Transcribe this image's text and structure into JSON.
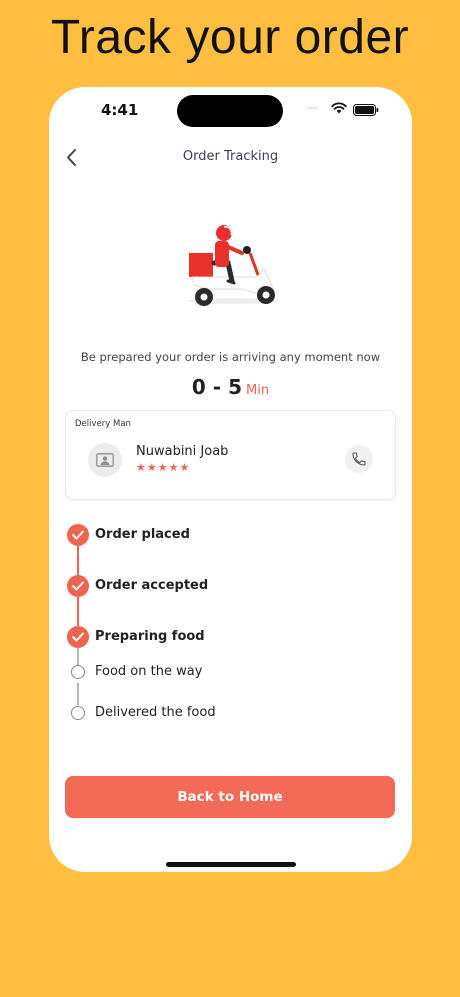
{
  "promo": {
    "title": "Track your order"
  },
  "status_bar": {
    "time": "4:41",
    "signal": "····"
  },
  "header": {
    "title": "Order Tracking"
  },
  "arrival": {
    "message": "Be prepared your order is arriving any moment now",
    "eta_value": "0 - 5",
    "eta_unit": "Min"
  },
  "delivery": {
    "label": "Delivery Man",
    "name": "Nuwabini Joab",
    "rating": 5,
    "stars": "★★★★★"
  },
  "steps": [
    {
      "label": "Order placed",
      "done": true
    },
    {
      "label": "Order accepted",
      "done": true
    },
    {
      "label": "Preparing food",
      "done": true
    },
    {
      "label": "Food on the way",
      "done": false
    },
    {
      "label": "Delivered the food",
      "done": false
    }
  ],
  "actions": {
    "back_home": "Back to Home"
  },
  "colors": {
    "background": "#FFBE40",
    "accent": "#F0634F",
    "button": "#F36B57"
  },
  "icons": {
    "back": "chevron-left-icon",
    "call": "phone-icon",
    "avatar": "user-placeholder-icon"
  }
}
